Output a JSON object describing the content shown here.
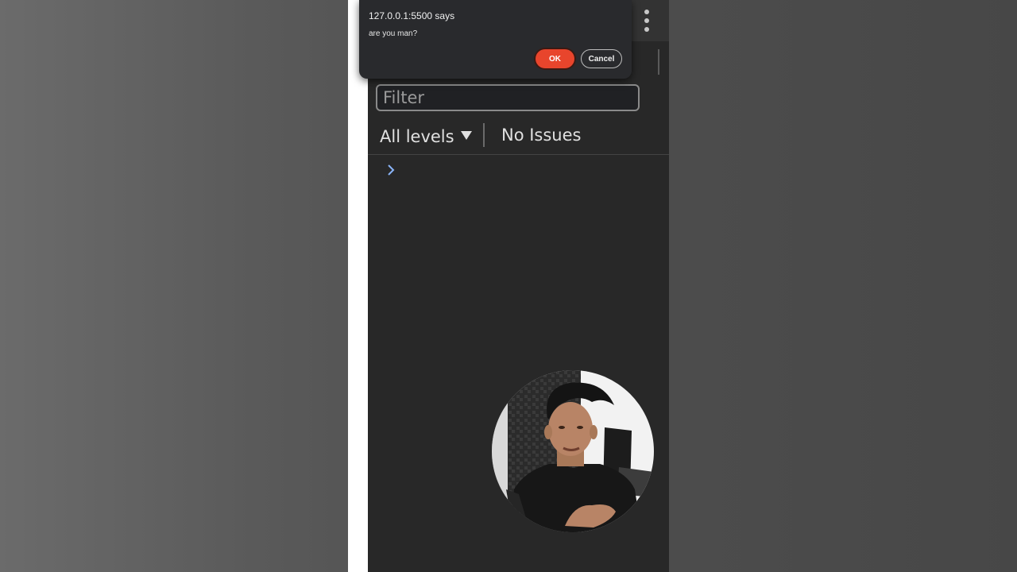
{
  "dialog": {
    "title": "127.0.0.1:5500 says",
    "message": "are you man?",
    "ok_label": "OK",
    "cancel_label": "Cancel"
  },
  "toolbar": {
    "more_icon": "kebab-menu-icon"
  },
  "console": {
    "filter_placeholder": "Filter",
    "levels_label": "All levels",
    "issues_label": "No Issues",
    "prompt_icon": "chevron-right-icon"
  },
  "colors": {
    "ok_button": "#e8452c",
    "panel_background": "#282828",
    "prompt_chevron": "#8ab4f8"
  }
}
